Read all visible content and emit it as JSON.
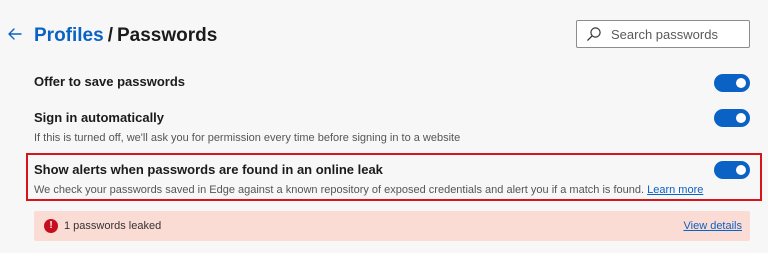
{
  "header": {
    "back_icon": "arrow-left-icon",
    "breadcrumb": {
      "parent": "Profiles",
      "separator": "/",
      "current": "Passwords"
    }
  },
  "search": {
    "icon": "search-icon",
    "placeholder": "Search passwords",
    "value": ""
  },
  "settings": [
    {
      "title": "Offer to save passwords",
      "enabled": true
    },
    {
      "title": "Sign in automatically",
      "description": "If this is turned off, we'll ask you for permission every time before signing in to a website",
      "enabled": true
    },
    {
      "title": "Show alerts when passwords are found in an online leak",
      "description": "We check your passwords saved in Edge against a known repository of exposed credentials and alert you if a match is found.",
      "link": "Learn more",
      "enabled": true,
      "highlighted": true
    }
  ],
  "leak_banner": {
    "icon": "error-icon",
    "text": "1 passwords leaked",
    "action": "View details"
  },
  "colors": {
    "accent": "#0a62c4",
    "highlight_border": "#d8131a",
    "banner_bg": "#fadcd5",
    "error": "#c50f1f"
  }
}
